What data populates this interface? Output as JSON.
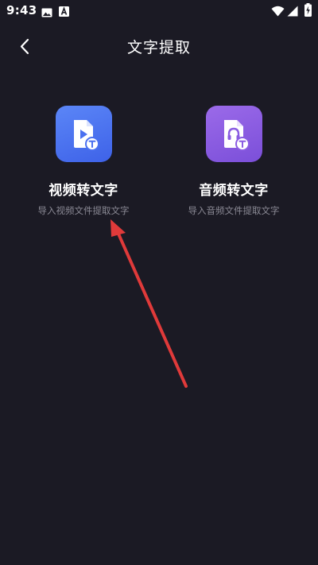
{
  "status_bar": {
    "time": "9:43",
    "icons": [
      "photo-icon",
      "font-a-icon",
      "wifi-icon",
      "signal-icon",
      "battery-charging-icon"
    ]
  },
  "header": {
    "title": "文字提取",
    "back_icon": "chevron-left-icon"
  },
  "features": [
    {
      "title": "视频转文字",
      "description": "导入视频文件提取文字",
      "icon": "video-file-text-icon",
      "accent": "#4a70f0"
    },
    {
      "title": "音频转文字",
      "description": "导入音频文件提取文字",
      "icon": "audio-file-text-icon",
      "accent": "#8a5ce2"
    }
  ],
  "colors": {
    "background": "#1b1a24",
    "annotation_arrow": "#e03a3a"
  }
}
